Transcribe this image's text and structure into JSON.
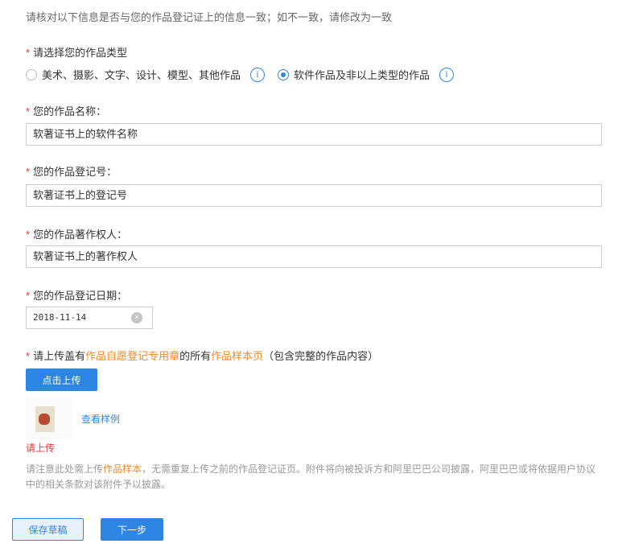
{
  "intro": "请核对以下信息是否与您的作品登记证上的信息一致；如不一致，请修改为一致",
  "required_mark": "*",
  "type_label": "请选择您的作品类型",
  "type_options": [
    {
      "label": "美术、摄影、文字、设计、模型、其他作品",
      "selected": false
    },
    {
      "label": "软件作品及非以上类型的作品",
      "selected": true
    }
  ],
  "info_glyph": "i",
  "name_label": "您的作品名称：",
  "name_value": "软著证书上的软件名称",
  "reg_label": "您的作品登记号：",
  "reg_value": "软著证书上的登记号",
  "owner_label": "您的作品著作权人：",
  "owner_value": "软著证书上的著作权人",
  "date_label": "您的作品登记日期：",
  "date_value": "2018-11-14",
  "upload_label": {
    "p1": "请上传盖有",
    "p2": "作品自愿登记专用章",
    "p3": "的所有",
    "p4": "作品样本页",
    "p5": "（包含完整的作品内容）"
  },
  "upload_button": "点击上传",
  "sample_link": "查看样例",
  "error": "请上传",
  "note": {
    "p1": "请注意此处需上传",
    "p2": "作品样本",
    "p3": "，无需重复上传之前的作品登记证页。附件将向被投诉方和阿里巴巴公司披露，阿里巴巴或将依据用户协议中的相关条款对该附件予以披露。"
  },
  "save_button": "保存草稿",
  "next_button": "下一步"
}
